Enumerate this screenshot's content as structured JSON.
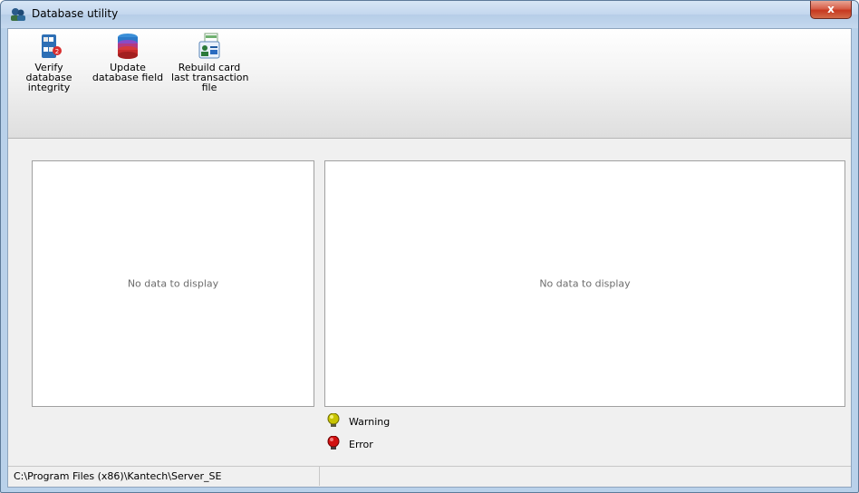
{
  "window": {
    "title": "Database utility",
    "close_glyph": "x"
  },
  "toolbar": {
    "buttons": [
      {
        "lines": [
          "Verify",
          "database",
          "integrity"
        ],
        "icon": "verify-database-icon"
      },
      {
        "lines": [
          "Update",
          "database field"
        ],
        "icon": "update-database-icon"
      },
      {
        "lines": [
          "Rebuild card",
          "last transaction",
          "file"
        ],
        "icon": "rebuild-card-icon"
      }
    ]
  },
  "panels": {
    "left_empty": "No data to display",
    "right_empty": "No data to display"
  },
  "legend": {
    "warning": "Warning",
    "error": "Error",
    "warning_color": "#c8c400",
    "error_color": "#d21010"
  },
  "statusbar": {
    "path": "C:\\Program Files (x86)\\Kantech\\Server_SE"
  }
}
